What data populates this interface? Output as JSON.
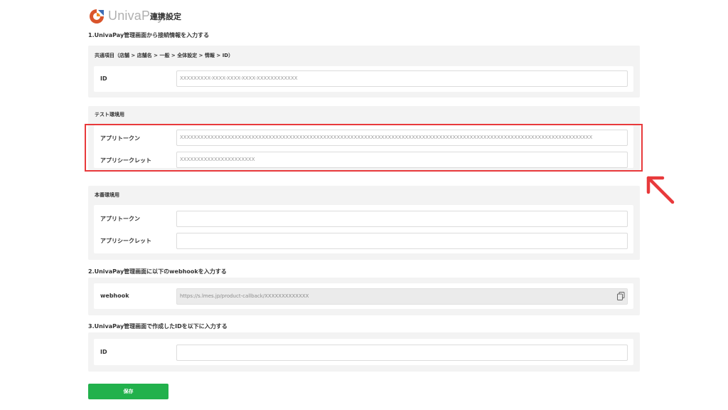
{
  "header": {
    "brand": "UnivaPay",
    "title": "連携設定"
  },
  "section1": {
    "title": "1.UnivaPay管理画面から接続情報を入力する",
    "common": {
      "label": "共通項目（店舗 > 店舗名 > 一般 > 全体設定 > 情報 > ID）",
      "id_label": "ID",
      "id_value": "XXXXXXXXX-XXXX-XXXX-XXXX-XXXXXXXXXXXX"
    },
    "test": {
      "label": "テスト環境用",
      "token_label": "アプリトークン",
      "token_value": "XXXXXXXXXXXXXXXXXXXXXXXXXXXXXXXXXXXXXXXXXXXXXXXXXXXXXXXXXXXXXXXXXXXXXXXXXXXXXXXXXXXXXXXXXXXXXXXXXXXXXXXXXXXXXXXXXXXXXXXXX",
      "secret_label": "アプリシークレット",
      "secret_value": "XXXXXXXXXXXXXXXXXXXXXX"
    },
    "production": {
      "label": "本番環境用",
      "token_label": "アプリトークン",
      "token_value": "",
      "secret_label": "アプリシークレット",
      "secret_value": ""
    }
  },
  "section2": {
    "title": "2.UnivaPay管理画面に以下のwebhookを入力する",
    "webhook_label": "webhook",
    "webhook_value": "https://s.lmes.jp/product-callback/XXXXXXXXXXXXX"
  },
  "section3": {
    "title": "3.UnivaPay管理画面で作成したIDを以下に入力する",
    "id_label": "ID",
    "id_value": ""
  },
  "actions": {
    "save_label": "保存"
  },
  "annotation": {
    "highlight_color": "#e8393b"
  },
  "colors": {
    "save_button": "#22b14c",
    "panel_bg": "#f3f3f3"
  }
}
